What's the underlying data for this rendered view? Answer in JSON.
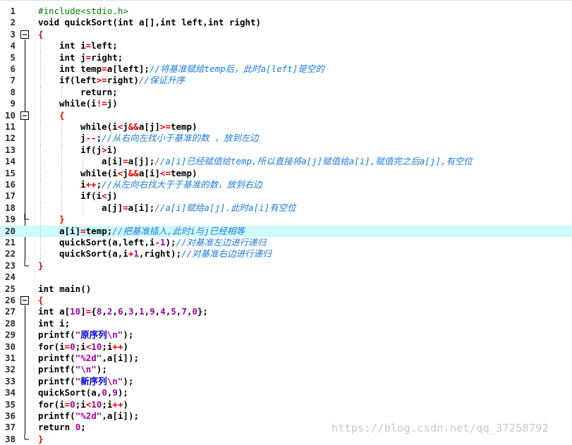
{
  "editor": {
    "highlight_line": 20,
    "lines": [
      {
        "n": "1",
        "fold": "",
        "indent": 0,
        "tokens": [
          [
            "pp",
            "#include<stdio.h>"
          ]
        ]
      },
      {
        "n": "2",
        "fold": "",
        "indent": 0,
        "tokens": [
          [
            "kw",
            "void quickSort(int a[],int left,int right)"
          ]
        ]
      },
      {
        "n": "3",
        "fold": "box",
        "indent": 0,
        "tokens": [
          [
            "op",
            "{"
          ]
        ]
      },
      {
        "n": "4",
        "fold": "",
        "indent": 1,
        "tokens": [
          [
            "kw",
            "int i"
          ],
          [
            "op",
            "="
          ],
          [
            "kw",
            "left;"
          ]
        ]
      },
      {
        "n": "5",
        "fold": "",
        "indent": 1,
        "tokens": [
          [
            "kw",
            "int j"
          ],
          [
            "op",
            "="
          ],
          [
            "kw",
            "right;"
          ]
        ]
      },
      {
        "n": "6",
        "fold": "",
        "indent": 1,
        "tokens": [
          [
            "kw",
            "int temp"
          ],
          [
            "op",
            "="
          ],
          [
            "kw",
            "a[left];"
          ],
          [
            "cmt",
            "//将基准赋给temp后，此时a[left]是空的"
          ]
        ]
      },
      {
        "n": "7",
        "fold": "",
        "indent": 1,
        "tokens": [
          [
            "kw",
            "if(left"
          ],
          [
            "op",
            ">="
          ],
          [
            "kw",
            "right)"
          ],
          [
            "cmt",
            "//保证升序"
          ]
        ]
      },
      {
        "n": "8",
        "fold": "",
        "indent": 2,
        "tokens": [
          [
            "kw",
            "return;"
          ]
        ]
      },
      {
        "n": "9",
        "fold": "",
        "indent": 1,
        "tokens": [
          [
            "kw",
            "while(i"
          ],
          [
            "op",
            "!="
          ],
          [
            "kw",
            "j)"
          ]
        ]
      },
      {
        "n": "10",
        "fold": "box",
        "indent": 1,
        "tokens": [
          [
            "op",
            "{"
          ]
        ]
      },
      {
        "n": "11",
        "fold": "",
        "indent": 2,
        "tokens": [
          [
            "kw",
            "while(i"
          ],
          [
            "op",
            "<"
          ],
          [
            "kw",
            "j"
          ],
          [
            "op",
            "&&"
          ],
          [
            "kw",
            "a[j]"
          ],
          [
            "op",
            ">="
          ],
          [
            "kw",
            "temp)"
          ]
        ]
      },
      {
        "n": "12",
        "fold": "",
        "indent": 2,
        "tokens": [
          [
            "kw",
            "j"
          ],
          [
            "op",
            "--"
          ],
          [
            "kw",
            ";"
          ],
          [
            "cmt",
            "//从右向左找小于基准的数 ，放到左边"
          ]
        ]
      },
      {
        "n": "13",
        "fold": "",
        "indent": 2,
        "tokens": [
          [
            "kw",
            "if(j"
          ],
          [
            "op",
            ">"
          ],
          [
            "kw",
            "i)"
          ]
        ]
      },
      {
        "n": "14",
        "fold": "",
        "indent": 3,
        "tokens": [
          [
            "kw",
            "a[i]"
          ],
          [
            "op",
            "="
          ],
          [
            "kw",
            "a[j];"
          ],
          [
            "cmt",
            "//a[i]已经赋值给temp,所以直接将a[j]赋值给a[i],赋值完之后a[j],有空位"
          ]
        ]
      },
      {
        "n": "15",
        "fold": "",
        "indent": 2,
        "tokens": [
          [
            "kw",
            "while(i"
          ],
          [
            "op",
            "<"
          ],
          [
            "kw",
            "j"
          ],
          [
            "op",
            "&&"
          ],
          [
            "kw",
            "a[i]"
          ],
          [
            "op",
            "<="
          ],
          [
            "kw",
            "temp)"
          ]
        ]
      },
      {
        "n": "16",
        "fold": "",
        "indent": 2,
        "tokens": [
          [
            "kw",
            "i"
          ],
          [
            "op",
            "++"
          ],
          [
            "kw",
            ";"
          ],
          [
            "cmt",
            "//从左向右找大于于基准的数，放到右边"
          ]
        ]
      },
      {
        "n": "17",
        "fold": "",
        "indent": 2,
        "tokens": [
          [
            "kw",
            "if(i"
          ],
          [
            "op",
            "<"
          ],
          [
            "kw",
            "j)"
          ]
        ]
      },
      {
        "n": "18",
        "fold": "",
        "indent": 3,
        "tokens": [
          [
            "kw",
            "a[j]"
          ],
          [
            "op",
            "="
          ],
          [
            "kw",
            "a[i];"
          ],
          [
            "cmt",
            "//a[i]赋给a[j].此时a[i]有空位"
          ]
        ]
      },
      {
        "n": "19",
        "fold": "end",
        "indent": 1,
        "tokens": [
          [
            "op",
            "}"
          ]
        ]
      },
      {
        "n": "20",
        "fold": "",
        "indent": 1,
        "tokens": [
          [
            "kw",
            "a[i]"
          ],
          [
            "op",
            "="
          ],
          [
            "kw",
            "temp;"
          ],
          [
            "cmt",
            "//把基准插入,此时i与j已经相等"
          ]
        ]
      },
      {
        "n": "21",
        "fold": "",
        "indent": 1,
        "tokens": [
          [
            "kw",
            "quickSort(a,left,i"
          ],
          [
            "op",
            "-"
          ],
          [
            "num",
            "1"
          ],
          [
            "kw",
            ");"
          ],
          [
            "cmt",
            "//对基准左边进行递归"
          ]
        ]
      },
      {
        "n": "22",
        "fold": "",
        "indent": 1,
        "tokens": [
          [
            "kw",
            "quickSort(a,i"
          ],
          [
            "op",
            "+"
          ],
          [
            "num",
            "1"
          ],
          [
            "kw",
            ",right);"
          ],
          [
            "cmt",
            "//对基准右边进行递归"
          ]
        ]
      },
      {
        "n": "23",
        "fold": "end",
        "indent": 0,
        "tokens": [
          [
            "op",
            "}"
          ]
        ]
      },
      {
        "n": "24",
        "fold": "",
        "indent": 0,
        "tokens": []
      },
      {
        "n": "25",
        "fold": "",
        "indent": 0,
        "tokens": [
          [
            "kw",
            "int main()"
          ]
        ]
      },
      {
        "n": "26",
        "fold": "box",
        "indent": 0,
        "tokens": [
          [
            "op",
            "{"
          ]
        ]
      },
      {
        "n": "27",
        "fold": "",
        "indent": 0,
        "tokens": [
          [
            "kw",
            "int a["
          ],
          [
            "num",
            "10"
          ],
          [
            "kw",
            "]"
          ],
          [
            "op",
            "="
          ],
          [
            "kw",
            "{"
          ],
          [
            "num",
            "8"
          ],
          [
            "kw",
            ","
          ],
          [
            "num",
            "2"
          ],
          [
            "kw",
            ","
          ],
          [
            "num",
            "6"
          ],
          [
            "kw",
            ","
          ],
          [
            "num",
            "3"
          ],
          [
            "kw",
            ","
          ],
          [
            "num",
            "1"
          ],
          [
            "kw",
            ","
          ],
          [
            "num",
            "9"
          ],
          [
            "kw",
            ","
          ],
          [
            "num",
            "4"
          ],
          [
            "kw",
            ","
          ],
          [
            "num",
            "5"
          ],
          [
            "kw",
            ","
          ],
          [
            "num",
            "7"
          ],
          [
            "kw",
            ","
          ],
          [
            "num",
            "0"
          ],
          [
            "kw",
            "};"
          ]
        ]
      },
      {
        "n": "28",
        "fold": "",
        "indent": 0,
        "tokens": [
          [
            "kw",
            "int i;"
          ]
        ]
      },
      {
        "n": "29",
        "fold": "",
        "indent": 0,
        "tokens": [
          [
            "kw",
            "printf("
          ],
          [
            "str",
            "\""
          ],
          [
            "strcn",
            "原序列"
          ],
          [
            "str",
            "\\n\""
          ],
          [
            "kw",
            ");"
          ]
        ]
      },
      {
        "n": "30",
        "fold": "",
        "indent": 0,
        "tokens": [
          [
            "kw",
            "for(i"
          ],
          [
            "op",
            "="
          ],
          [
            "num",
            "0"
          ],
          [
            "kw",
            ";i"
          ],
          [
            "op",
            "<"
          ],
          [
            "num",
            "10"
          ],
          [
            "kw",
            ";i"
          ],
          [
            "op",
            "++"
          ],
          [
            "kw",
            ")"
          ]
        ]
      },
      {
        "n": "31",
        "fold": "",
        "indent": 0,
        "tokens": [
          [
            "kw",
            "printf("
          ],
          [
            "str",
            "\"%2d\""
          ],
          [
            "kw",
            ",a[i]);"
          ]
        ]
      },
      {
        "n": "32",
        "fold": "",
        "indent": 0,
        "tokens": [
          [
            "kw",
            "printf("
          ],
          [
            "str",
            "\"\\n\""
          ],
          [
            "kw",
            ");"
          ]
        ]
      },
      {
        "n": "33",
        "fold": "",
        "indent": 0,
        "tokens": [
          [
            "kw",
            "printf("
          ],
          [
            "str",
            "\""
          ],
          [
            "strcn",
            "新序列"
          ],
          [
            "str",
            "\\n\""
          ],
          [
            "kw",
            ");"
          ]
        ]
      },
      {
        "n": "34",
        "fold": "",
        "indent": 0,
        "tokens": [
          [
            "kw",
            "quickSort(a,"
          ],
          [
            "num",
            "0"
          ],
          [
            "kw",
            ","
          ],
          [
            "num",
            "9"
          ],
          [
            "kw",
            ");"
          ]
        ]
      },
      {
        "n": "35",
        "fold": "",
        "indent": 0,
        "tokens": [
          [
            "kw",
            "for(i"
          ],
          [
            "op",
            "="
          ],
          [
            "num",
            "0"
          ],
          [
            "kw",
            ";i"
          ],
          [
            "op",
            "<"
          ],
          [
            "num",
            "10"
          ],
          [
            "kw",
            ";i"
          ],
          [
            "op",
            "++"
          ],
          [
            "kw",
            ")"
          ]
        ]
      },
      {
        "n": "36",
        "fold": "",
        "indent": 0,
        "tokens": [
          [
            "kw",
            "printf("
          ],
          [
            "str",
            "\"%2d\""
          ],
          [
            "kw",
            ",a[i]);"
          ]
        ]
      },
      {
        "n": "37",
        "fold": "",
        "indent": 0,
        "tokens": [
          [
            "kw",
            "return "
          ],
          [
            "num",
            "0"
          ],
          [
            "kw",
            ";"
          ]
        ]
      },
      {
        "n": "38",
        "fold": "end",
        "indent": 0,
        "tokens": [
          [
            "op",
            "}"
          ]
        ]
      }
    ]
  },
  "watermark": "https://blog.csdn.net/qq_37258792",
  "colors": {
    "highlight": "#cffafb",
    "operator": "#e00000",
    "number": "#a000a0",
    "comment": "#1e7bd8",
    "preprocessor": "#008000",
    "chinese_string": "#0000cc"
  }
}
